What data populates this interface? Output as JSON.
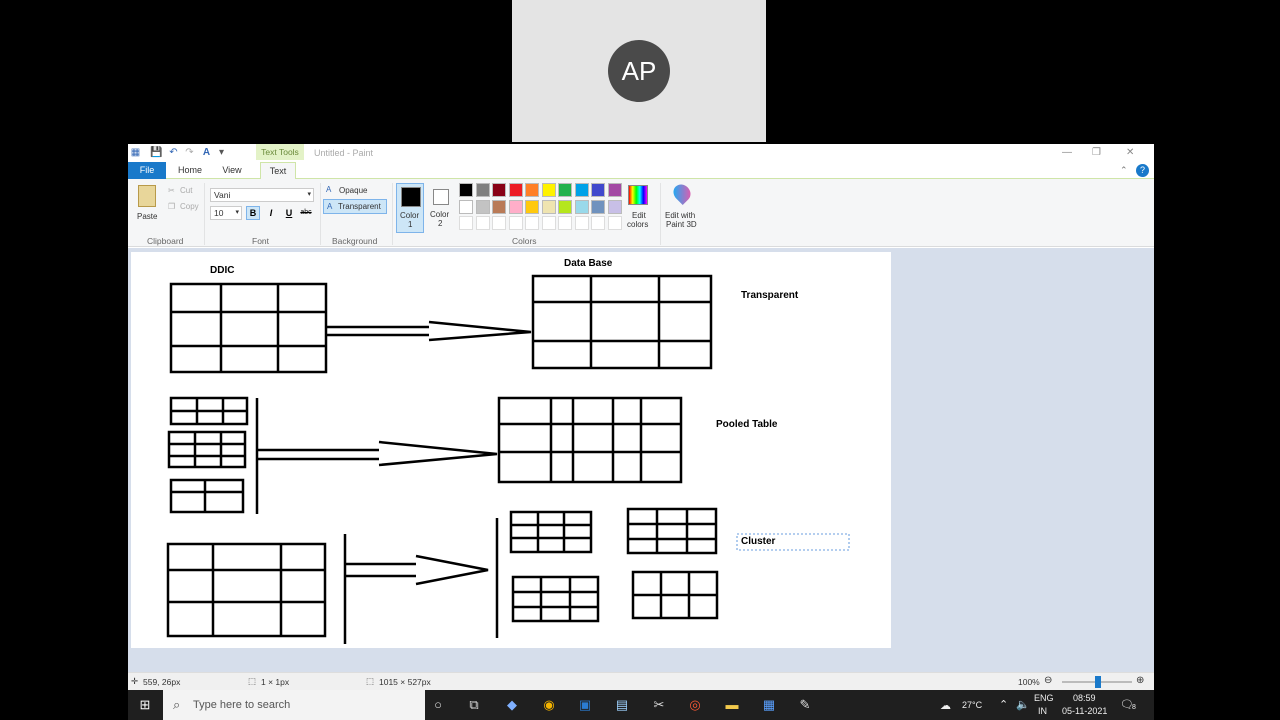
{
  "meeting": {
    "avatar_initials": "AP"
  },
  "window": {
    "context_tab": "Text Tools",
    "title": "Untitled - Paint",
    "tabs": [
      "File",
      "Home",
      "View",
      "Text"
    ]
  },
  "ribbon": {
    "clipboard": {
      "paste": "Paste",
      "cut": "Cut",
      "copy": "Copy",
      "group": "Clipboard"
    },
    "font": {
      "family": "Vani",
      "size": "10",
      "bold": "B",
      "italic": "I",
      "underline": "U",
      "strike": "abc",
      "group": "Font"
    },
    "background": {
      "opaque": "Opaque",
      "transparent": "Transparent",
      "group": "Background"
    },
    "colors": {
      "color1_label": "Color",
      "color1_num": "1",
      "color2_label": "Color",
      "color2_num": "2",
      "edit_line1": "Edit",
      "edit_line2": "colors",
      "paint3d_line1": "Edit with",
      "paint3d_line2": "Paint 3D",
      "group": "Colors",
      "palette_row1": [
        "#000000",
        "#7f7f7f",
        "#880015",
        "#ed1c24",
        "#ff7f27",
        "#fff200",
        "#22b14c",
        "#00a2e8",
        "#3f48cc",
        "#a349a4"
      ],
      "palette_row2": [
        "#ffffff",
        "#c3c3c3",
        "#b97a57",
        "#ffaec9",
        "#ffc90e",
        "#efe4b0",
        "#b5e61d",
        "#99d9ea",
        "#7092be",
        "#c8bfe7"
      ]
    }
  },
  "drawing": {
    "ddic": "DDIC",
    "database": "Data Base",
    "transparent": "Transparent",
    "pooled": "Pooled Table",
    "cluster": "Cluster"
  },
  "status": {
    "cursor": "559, 26px",
    "selection": "1 × 1px",
    "canvas_size": "1015 × 527px",
    "zoom": "100%"
  },
  "taskbar": {
    "search_placeholder": "Type here to search",
    "weather": "27°C",
    "lang1": "ENG",
    "lang2": "IN",
    "time": "08:59",
    "date": "05-11-2021",
    "notifications": "8"
  }
}
